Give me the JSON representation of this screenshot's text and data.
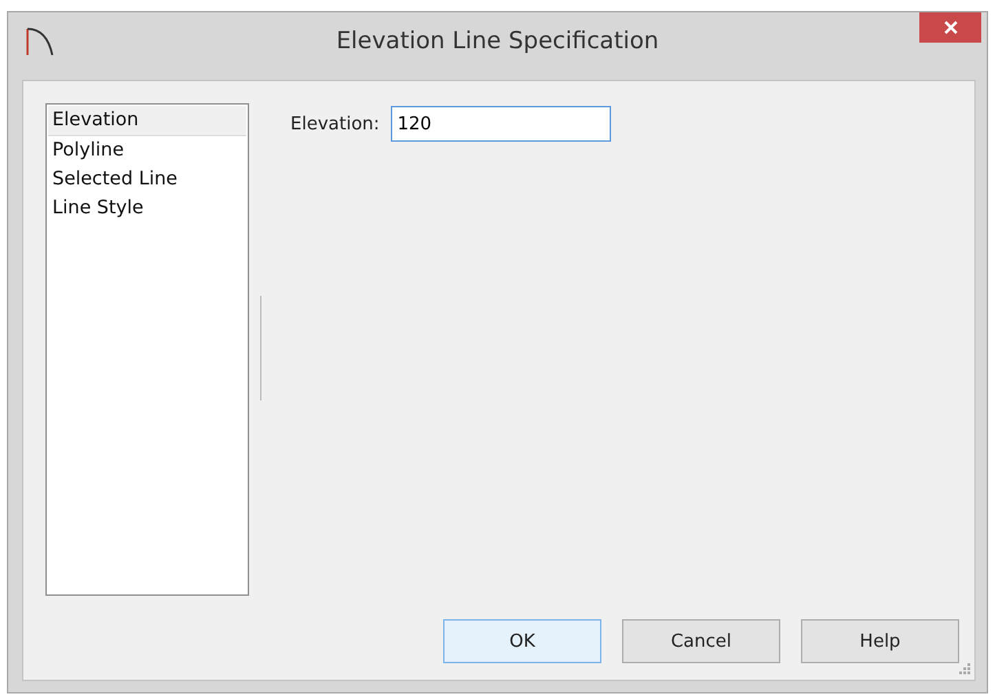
{
  "window": {
    "title": "Elevation Line Specification"
  },
  "sidebar": {
    "items": [
      {
        "label": "Elevation",
        "selected": true
      },
      {
        "label": "Polyline",
        "selected": false
      },
      {
        "label": "Selected Line",
        "selected": false
      },
      {
        "label": "Line Style",
        "selected": false
      }
    ]
  },
  "field": {
    "label": "Elevation:",
    "value": "120"
  },
  "buttons": [
    {
      "label": "OK",
      "focused": true
    },
    {
      "label": "Cancel",
      "focused": false
    },
    {
      "label": "Help",
      "focused": false
    }
  ]
}
